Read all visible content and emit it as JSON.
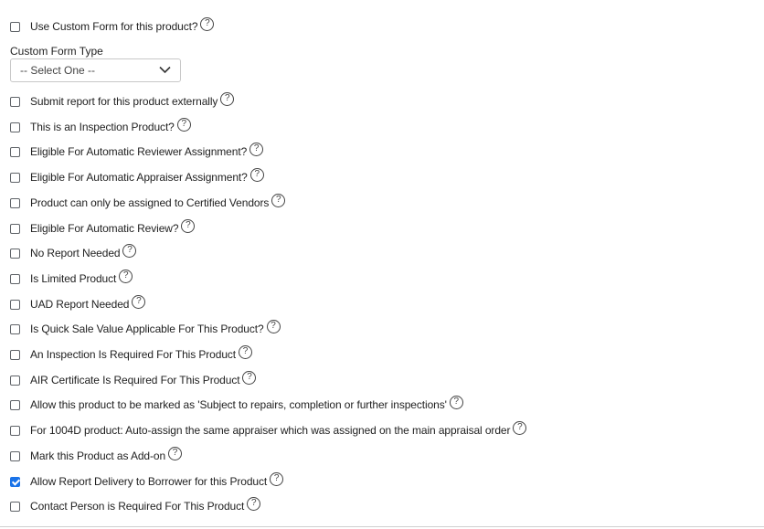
{
  "custom_form": {
    "use_label": "Use Custom Form for this product?",
    "type_label": "Custom Form Type",
    "type_selected": "-- Select One --"
  },
  "options": [
    {
      "label": "Submit report for this product externally",
      "checked": false
    },
    {
      "label": "This is an Inspection Product?",
      "checked": false
    },
    {
      "label": "Eligible For Automatic Reviewer Assignment?",
      "checked": false
    },
    {
      "label": "Eligible For Automatic Appraiser Assignment?",
      "checked": false
    },
    {
      "label": "Product can only be assigned to Certified Vendors",
      "checked": false
    },
    {
      "label": "Eligible For Automatic Review?",
      "checked": false
    },
    {
      "label": "No Report Needed",
      "checked": false
    },
    {
      "label": "Is Limited Product",
      "checked": false
    },
    {
      "label": "UAD Report Needed",
      "checked": false
    },
    {
      "label": "Is Quick Sale Value Applicable For This Product?",
      "checked": false
    },
    {
      "label": "An Inspection Is Required For This Product",
      "checked": false
    },
    {
      "label": "AIR Certificate Is Required For This Product",
      "checked": false
    },
    {
      "label": "Allow this product to be marked as 'Subject to repairs, completion or further inspections'",
      "checked": false
    },
    {
      "label": "For 1004D product: Auto-assign the same appraiser which was assigned on the main appraisal order",
      "checked": false
    },
    {
      "label": "Mark this Product as Add-on",
      "checked": false
    },
    {
      "label": "Allow Report Delivery to Borrower for this Product",
      "checked": true
    },
    {
      "label": "Contact Person is Required For This Product",
      "checked": false
    }
  ],
  "help_glyph": "?",
  "colors": {
    "checkbox_checked": "#1a73e8",
    "text": "#222222"
  }
}
